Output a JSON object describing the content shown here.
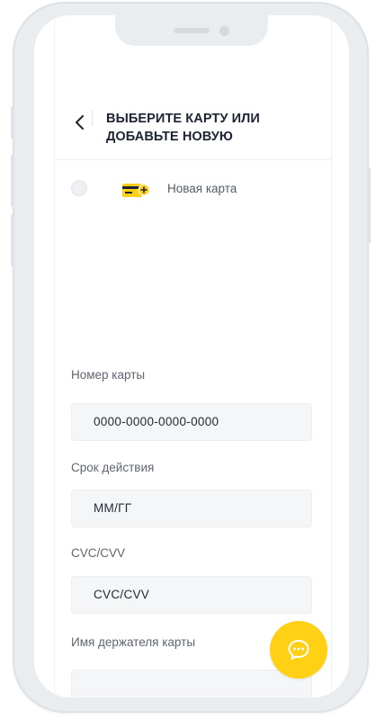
{
  "header": {
    "back_icon": "chevron-left-icon",
    "title": "ВЫБЕРИТЕ КАРТУ ИЛИ ДОБАВЬТЕ НОВУЮ"
  },
  "card_option": {
    "icon": "card-plus-icon",
    "label": "Новая карта",
    "selected": false
  },
  "form": {
    "card_number_label": "Номер карты",
    "card_number_placeholder": "0000-0000-0000-0000",
    "expiry_label": "Срок действия",
    "expiry_placeholder": "ММ/ГГ",
    "cvc_label": "CVC/CVV",
    "cvc_placeholder": "CVC/CVV",
    "holder_label": "Имя держателя карты",
    "holder_placeholder": ""
  },
  "chat": {
    "icon": "chat-bubble-icon"
  },
  "colors": {
    "accent": "#ffd014",
    "title": "#1c2433",
    "field_bg": "#f5f6f7"
  }
}
